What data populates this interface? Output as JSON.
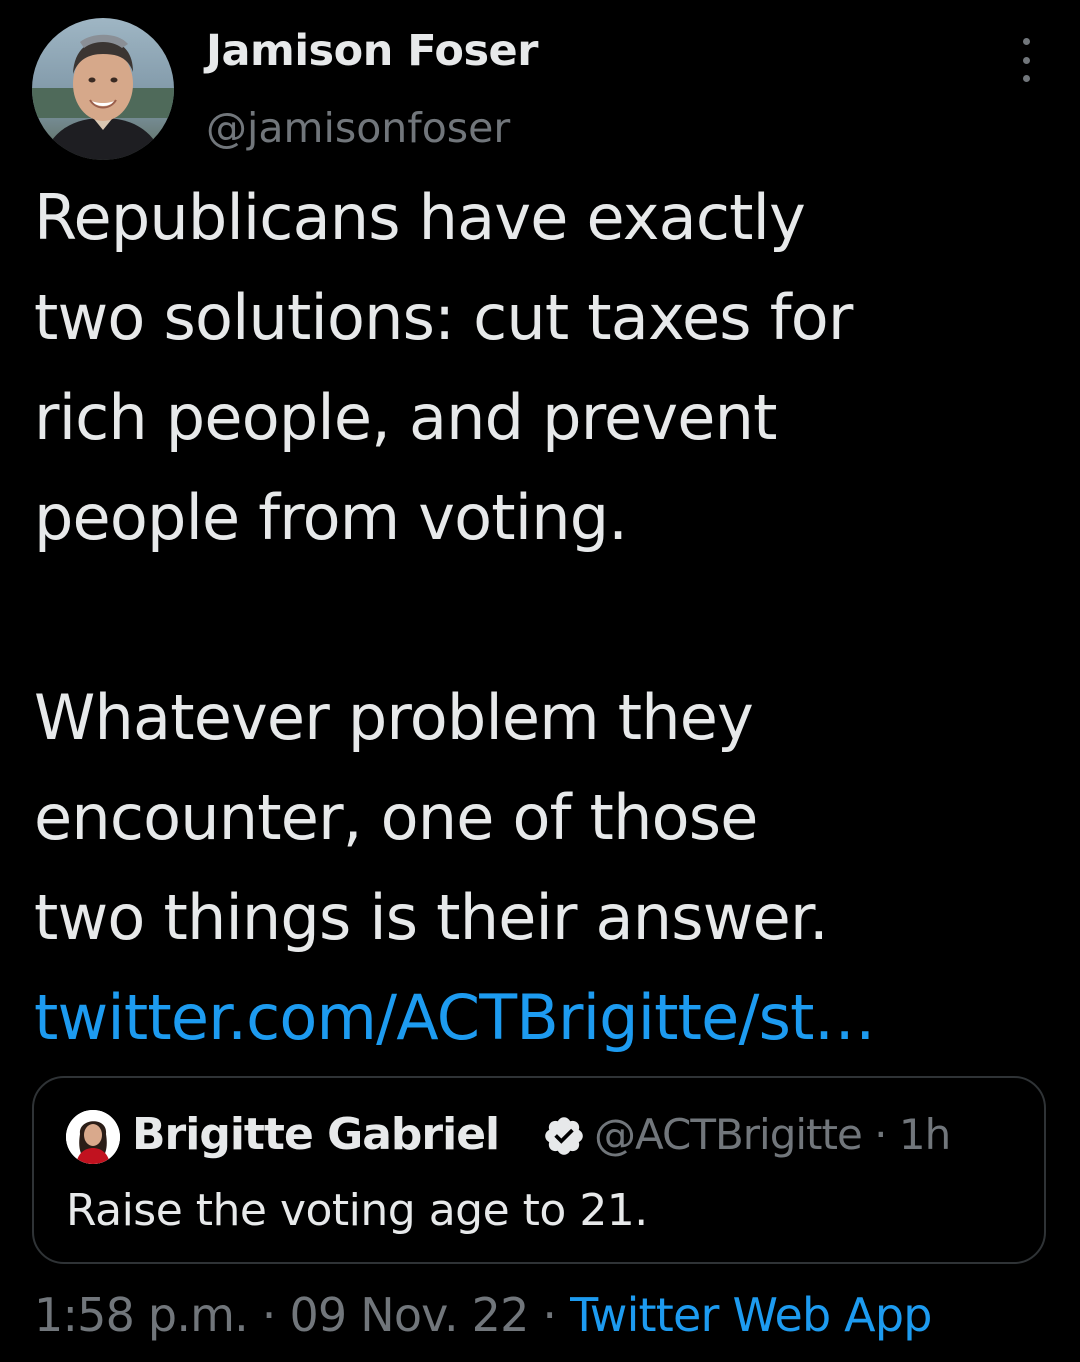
{
  "author": {
    "display_name": "Jamison Foser",
    "handle": "@jamisonfoser",
    "avatar_icon": "profile-photo"
  },
  "tweet": {
    "paragraph_1": "Republicans have exactly two solutions: cut taxes for rich people, and prevent people from voting.",
    "paragraph_1_lines": [
      "Republicans have exactly",
      "two solutions: cut taxes for",
      "rich people, and prevent",
      "people from voting."
    ],
    "paragraph_2_lines": [
      "Whatever problem they",
      "encounter, one of those",
      "two things is their answer."
    ],
    "link_text": "twitter.com/ACTBrigitte/st…"
  },
  "quote": {
    "display_name": "Brigitte Gabriel",
    "verified_icon": "verified-badge-icon",
    "handle": "@ACTBrigitte",
    "separator": "·",
    "time": "1h",
    "meta": "@ACTBrigitte · 1h",
    "text": "Raise the voting age to 21."
  },
  "footer": {
    "time": "1:58 p.m.",
    "date": "09 Nov. 22",
    "separator": " · ",
    "source": "Twitter Web App"
  },
  "menu_icon": "more-vertical-icon",
  "colors": {
    "background": "#000000",
    "primary_text": "#e7e9ea",
    "secondary_text": "#71767b",
    "link": "#1d9bf0",
    "border": "#2f3336"
  }
}
